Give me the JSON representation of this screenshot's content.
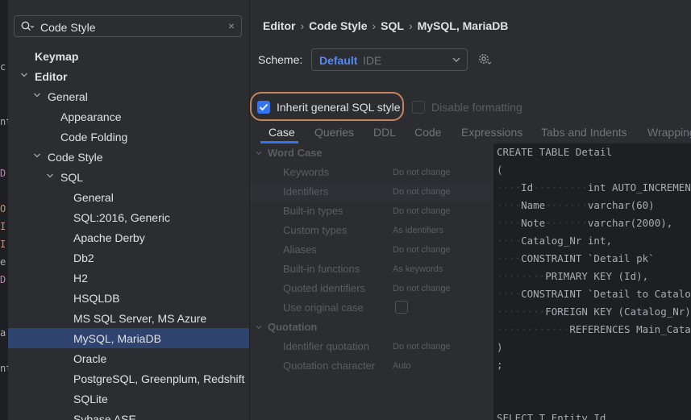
{
  "sidebar": {
    "search": {
      "value": "Code Style",
      "clear_glyph": "×",
      "icon": "search-icon"
    },
    "tree": [
      {
        "label": "Keymap",
        "level": 0,
        "chevron": "none",
        "bold": true
      },
      {
        "label": "Editor",
        "level": 0,
        "chevron": "down",
        "bold": true
      },
      {
        "label": "General",
        "level": 1,
        "chevron": "down"
      },
      {
        "label": "Appearance",
        "level": 2,
        "chevron": "none"
      },
      {
        "label": "Code Folding",
        "level": 2,
        "chevron": "none"
      },
      {
        "label": "Code Style",
        "level": 1,
        "chevron": "down"
      },
      {
        "label": "SQL",
        "level": 2,
        "chevron": "down"
      },
      {
        "label": "General",
        "level": 3,
        "chevron": "none"
      },
      {
        "label": "SQL:2016, Generic",
        "level": 3,
        "chevron": "none"
      },
      {
        "label": "Apache Derby",
        "level": 3,
        "chevron": "none"
      },
      {
        "label": "Db2",
        "level": 3,
        "chevron": "none"
      },
      {
        "label": "H2",
        "level": 3,
        "chevron": "none"
      },
      {
        "label": "HSQLDB",
        "level": 3,
        "chevron": "none"
      },
      {
        "label": "MS SQL Server, MS Azure",
        "level": 3,
        "chevron": "none"
      },
      {
        "label": "MySQL, MariaDB",
        "level": 3,
        "chevron": "none",
        "selected": true
      },
      {
        "label": "Oracle",
        "level": 3,
        "chevron": "none"
      },
      {
        "label": "PostgreSQL, Greenplum, Redshift",
        "level": 3,
        "chevron": "none"
      },
      {
        "label": "SQLite",
        "level": 3,
        "chevron": "none"
      },
      {
        "label": "Sybase ASE",
        "level": 3,
        "chevron": "none"
      }
    ]
  },
  "breadcrumb": [
    "Editor",
    "Code Style",
    "SQL",
    "MySQL, MariaDB"
  ],
  "breadcrumb_sep": "›",
  "scheme": {
    "label": "Scheme:",
    "value": "Default",
    "suffix": "IDE"
  },
  "inherit_checkbox": {
    "label": "Inherit general SQL style",
    "checked": true
  },
  "disable_checkbox": {
    "label": "Disable formatting",
    "checked": false
  },
  "tabs": [
    "Case",
    "Queries",
    "DDL",
    "Code",
    "Expressions",
    "Tabs and Indents",
    "Wrapping"
  ],
  "active_tab": "Case",
  "options": {
    "word_case": {
      "title": "Word Case",
      "items": [
        {
          "name": "Keywords",
          "value": "Do not change"
        },
        {
          "name": "Identifiers",
          "value": "Do not change"
        },
        {
          "name": "Built-in types",
          "value": "Do not change"
        },
        {
          "name": "Custom types",
          "value": "As identifiers"
        },
        {
          "name": "Aliases",
          "value": "Do not change"
        },
        {
          "name": "Built-in functions",
          "value": "As keywords"
        },
        {
          "name": "Quoted identifiers",
          "value": "Do not change"
        },
        {
          "name": "Use original case",
          "value": ""
        }
      ]
    },
    "quotation": {
      "title": "Quotation",
      "items": [
        {
          "name": "Identifier quotation",
          "value": "Do not change"
        },
        {
          "name": "Quotation character",
          "value": "Auto"
        }
      ]
    }
  },
  "preview_lines": [
    "CREATE TABLE Detail",
    "(",
    "····Id·········int AUTO_INCREMENT",
    "····Name·······varchar(60)",
    "····Note·······varchar(2000),",
    "····Catalog_Nr int,",
    "····CONSTRAINT `Detail pk`",
    "········PRIMARY KEY (Id),",
    "····CONSTRAINT `Detail to Catalog`",
    "········FOREIGN KEY (Catalog_Nr)",
    "············REFERENCES Main_Catalog",
    ")",
    ";",
    "",
    "",
    "SELECT T.Entity_Id"
  ],
  "colors": {
    "accent": "#3574f0",
    "selection": "#2e436e",
    "highlight_ring": "#c4825e",
    "scheme_value": "#548af7"
  },
  "left_edge_glyphs": [
    "c",
    "nt",
    "D",
    "O",
    "I",
    "I",
    "e",
    "D",
    "a",
    "nt"
  ]
}
